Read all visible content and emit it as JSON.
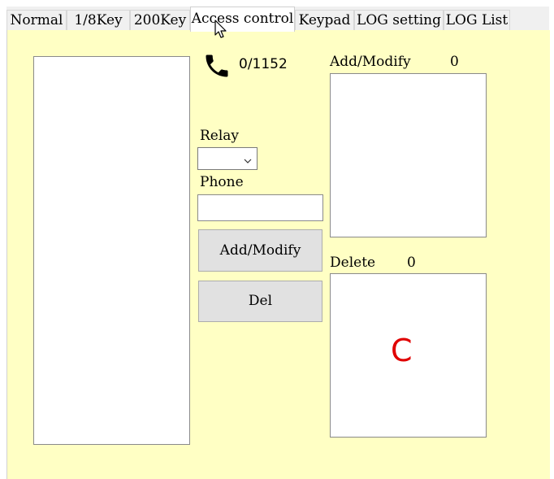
{
  "tabs": [
    {
      "label": "Normal"
    },
    {
      "label": "1/8Key"
    },
    {
      "label": "200Key"
    },
    {
      "label": "Access control"
    },
    {
      "label": "Keypad"
    },
    {
      "label": "LOG setting"
    },
    {
      "label": "LOG List"
    }
  ],
  "access": {
    "phone_count": "0/1152",
    "relay_label": "Relay",
    "relay_value": "",
    "phone_label": "Phone",
    "phone_value": "",
    "add_modify_button": "Add/Modify",
    "del_button": "Del",
    "add_modify_label": "Add/Modify",
    "add_modify_count": "0",
    "delete_label": "Delete",
    "delete_count": "0",
    "annotation": "C"
  },
  "colors": {
    "panel_bg": "#ffffc4",
    "annotation": "#e00000"
  }
}
